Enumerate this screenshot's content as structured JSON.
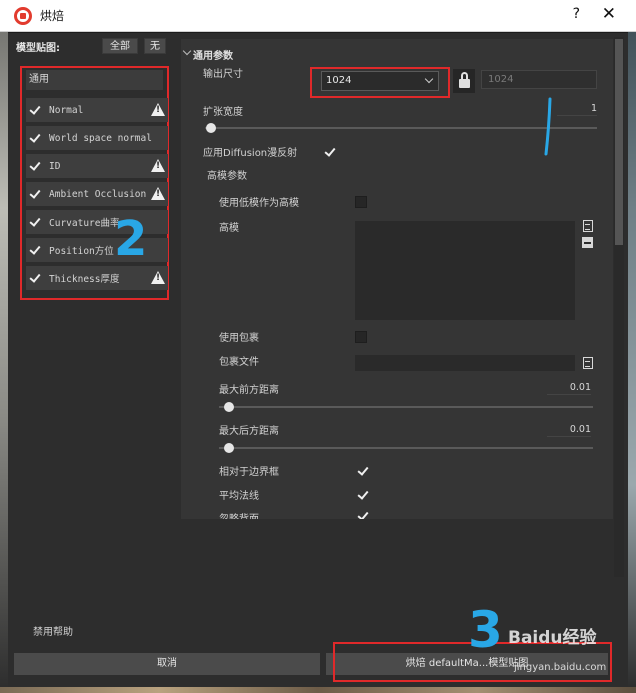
{
  "window": {
    "title": "烘焙",
    "help_glyph": "?",
    "close_glyph": "✕"
  },
  "left_panel": {
    "header": "模型贴图:",
    "select_all": "全部",
    "select_none": "无",
    "group_title": "通用",
    "items": [
      {
        "label": "Normal",
        "checked": true,
        "warning": true
      },
      {
        "label": "World space normal",
        "checked": true,
        "warning": false
      },
      {
        "label": "ID",
        "checked": true,
        "warning": true
      },
      {
        "label": "Ambient Occlusion",
        "checked": true,
        "warning": true
      },
      {
        "label": "Curvature曲率",
        "checked": true,
        "warning": false
      },
      {
        "label": "Position方位",
        "checked": true,
        "warning": false
      },
      {
        "label": "Thickness厚度",
        "checked": true,
        "warning": true
      }
    ]
  },
  "right_panel": {
    "section_title": "通用参数",
    "output_size_label": "输出尺寸",
    "output_size_value": "1024",
    "output_size_locked_value": "1024",
    "dilation_label": "扩张宽度",
    "dilation_value": "1",
    "dilation_fraction": 0.0,
    "diffusion_label": "应用Diffusion漫反射",
    "diffusion_checked": true,
    "high_poly_params_label": "高模参数",
    "use_low_as_high_label": "使用低模作为高模",
    "use_low_as_high_checked": false,
    "high_poly_label": "高模",
    "use_cage_label": "使用包裹",
    "use_cage_checked": false,
    "cage_file_label": "包裹文件",
    "max_front_label": "最大前方距离",
    "max_front_value": "0.01",
    "max_front_fraction": 0.01,
    "max_rear_label": "最大后方距离",
    "max_rear_value": "0.01",
    "max_rear_fraction": 0.01,
    "relative_bbox_label": "相对于边界框",
    "relative_bbox_checked": true,
    "average_normals_label": "平均法线",
    "average_normals_checked": true,
    "ignore_backface_label": "忽略背面",
    "ignore_backface_checked": true
  },
  "footer": {
    "disable_help": "禁用帮助",
    "cancel": "取消",
    "bake": "烘焙 defaultMa...模型贴图"
  },
  "annotations": {
    "marker_2": "2",
    "marker_3": "3",
    "watermark": "Baidu经验",
    "watermark_url": "jingyan.baidu.com"
  },
  "colors": {
    "highlight_box": "#e0292a",
    "annotation_blue": "#29a7e6",
    "logo_red": "#e23b2e"
  }
}
